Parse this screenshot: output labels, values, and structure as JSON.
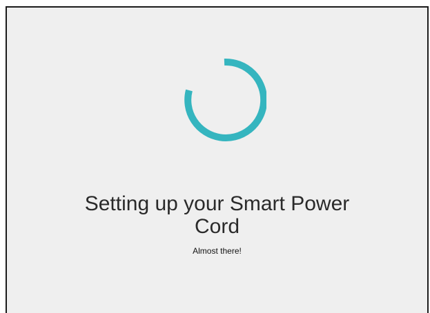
{
  "setup": {
    "title_line1": "Setting up your Smart Power",
    "title_line2": "Cord",
    "subtitle": "Almost there!"
  },
  "spinner": {
    "icon": "loading-spinner-icon",
    "color": "#35b5bf"
  },
  "colors": {
    "background": "#efefef",
    "border": "#1a1a1a",
    "text": "#2a2a2a"
  }
}
